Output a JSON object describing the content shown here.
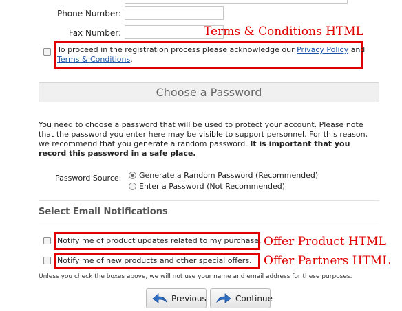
{
  "form": {
    "phone_label": "Phone Number:",
    "fax_label": "Fax Number:",
    "phone_value": "",
    "fax_value": ""
  },
  "terms": {
    "text_before": "To proceed in the registration process please acknowledge our ",
    "privacy_link": "Privacy Policy",
    "and": " and",
    "terms_link": "Terms & Conditions",
    "period": ".",
    "annotation": "Terms & Conditions HTML"
  },
  "password": {
    "section_title": "Choose a Password",
    "para_normal": "You need to choose a password that will be used to protect your account. Please note that the password you enter here may be visible to support personnel. For this reason, we recommend that you generate a random password. ",
    "para_bold": "It is important that you record this password in a safe place.",
    "source_label": "Password Source:",
    "option_generate": "Generate a Random Password (Recommended)",
    "option_enter": "Enter a Password (Not Recommended)",
    "selected": "generate"
  },
  "notifications": {
    "section_title": "Select Email Notifications",
    "product_updates": "Notify me of product updates related to my purchase.",
    "new_products": "Notify me of new products and other special offers.",
    "product_annotation": "Offer Product HTML",
    "partners_annotation": "Offer Partners HTML",
    "disclaimer": "Unless you check the boxes above, we will not use your name and email address for these purposes."
  },
  "buttons": {
    "previous": "Previous",
    "continue": "Continue"
  },
  "colors": {
    "annotation_red": "#e00000",
    "link_blue": "#1a55aa",
    "arrow_blue": "#2f6fc4"
  }
}
